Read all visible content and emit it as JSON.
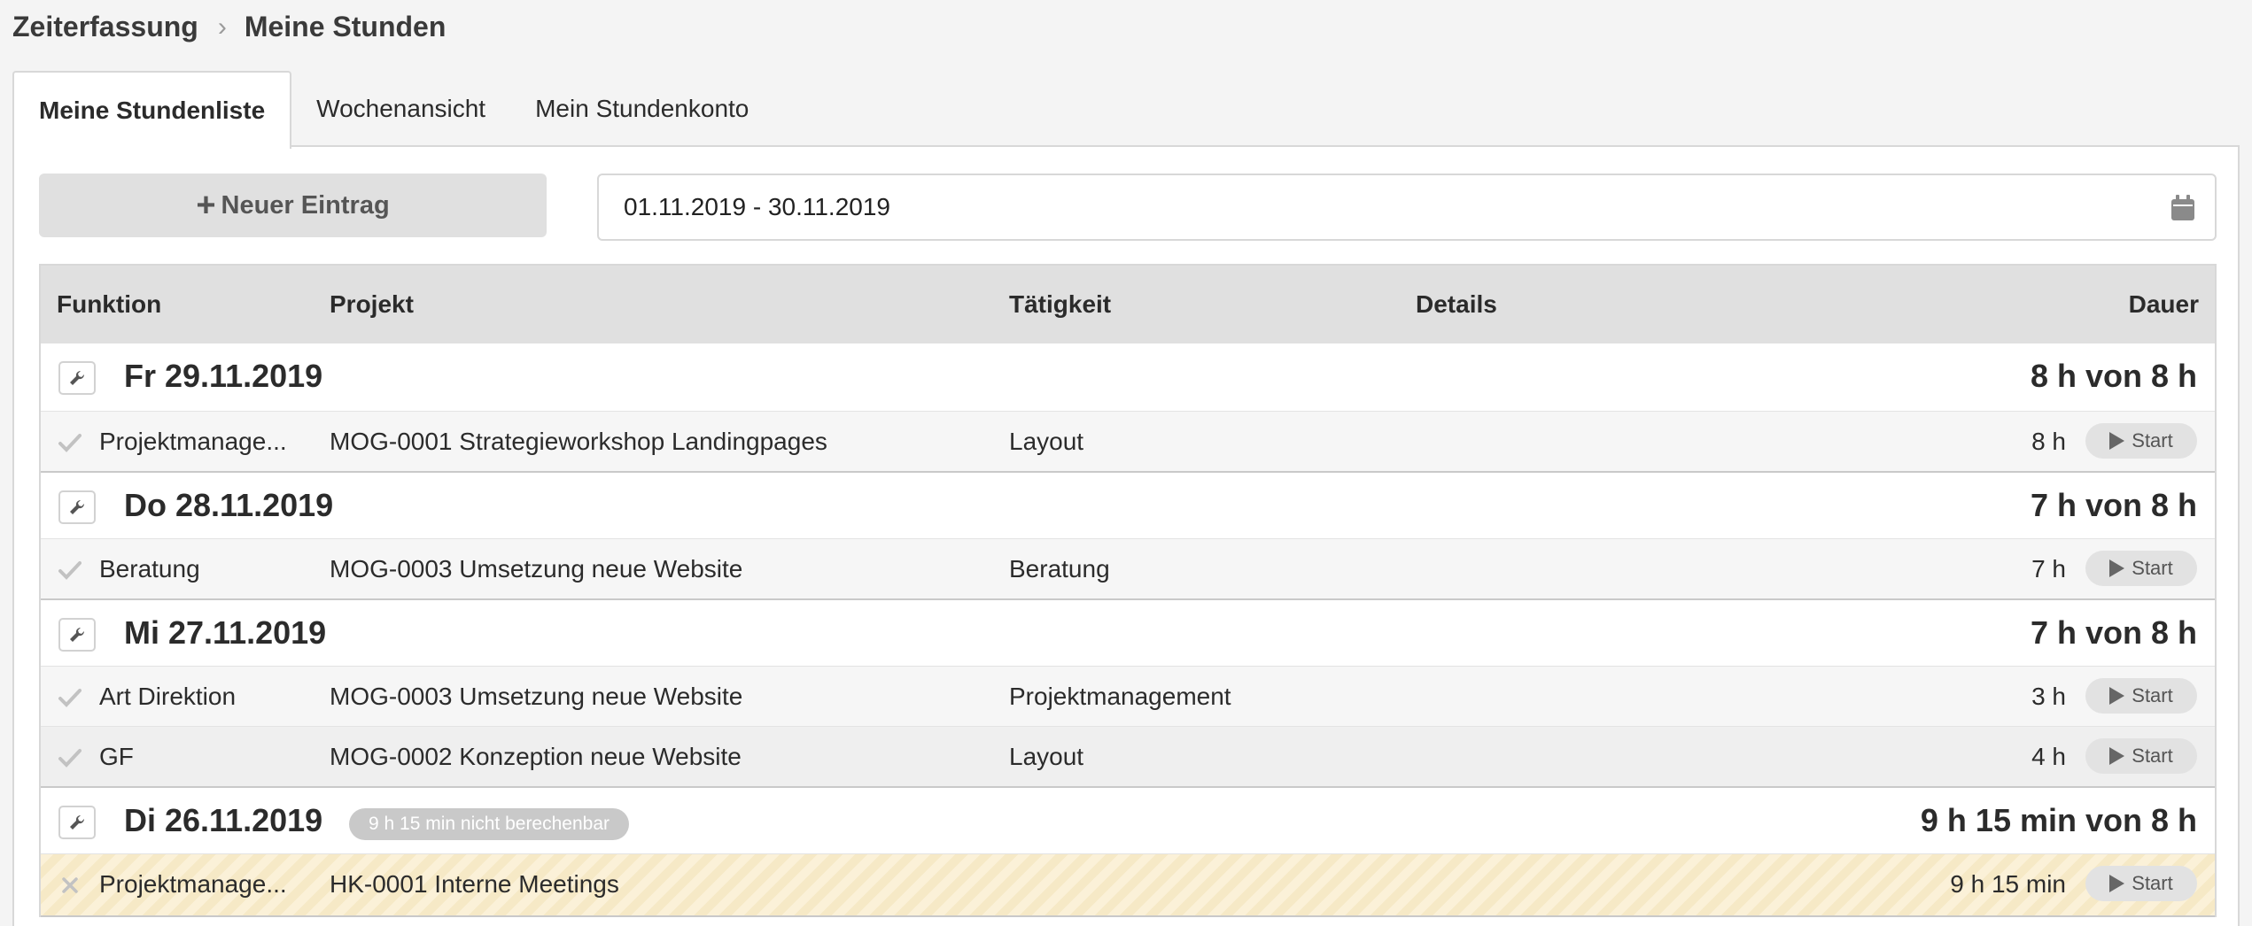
{
  "breadcrumb": {
    "parent": "Zeiterfassung",
    "separator": "›",
    "current": "Meine Stunden"
  },
  "tabs": [
    {
      "label": "Meine Stundenliste",
      "active": true
    },
    {
      "label": "Wochenansicht",
      "active": false
    },
    {
      "label": "Mein Stundenkonto",
      "active": false
    }
  ],
  "toolbar": {
    "new_entry_label": "Neuer Eintrag",
    "date_range": "01.11.2019 - 30.11.2019"
  },
  "table": {
    "headers": {
      "funktion": "Funktion",
      "projekt": "Projekt",
      "taetigkeit": "Tätigkeit",
      "details": "Details",
      "dauer": "Dauer"
    },
    "start_label": "Start",
    "days": [
      {
        "title": "Fr 29.11.2019",
        "total": "8 h von 8 h",
        "badge": "",
        "entries": [
          {
            "status": "check",
            "funktion": "Projektmanage...",
            "projekt": "MOG-0001 Strategieworkshop Landingpages",
            "taetigkeit": "Layout",
            "details": "",
            "dauer": "8 h"
          }
        ]
      },
      {
        "title": "Do 28.11.2019",
        "total": "7 h von 8 h",
        "badge": "",
        "entries": [
          {
            "status": "check",
            "funktion": "Beratung",
            "projekt": "MOG-0003 Umsetzung neue Website",
            "taetigkeit": "Beratung",
            "details": "",
            "dauer": "7 h"
          }
        ]
      },
      {
        "title": "Mi 27.11.2019",
        "total": "7 h von 8 h",
        "badge": "",
        "entries": [
          {
            "status": "check",
            "funktion": "Art Direktion",
            "projekt": "MOG-0003 Umsetzung neue Website",
            "taetigkeit": "Projektmanagement",
            "details": "",
            "dauer": "3 h"
          },
          {
            "status": "check",
            "funktion": "GF",
            "projekt": "MOG-0002 Konzeption neue Website",
            "taetigkeit": "Layout",
            "details": "",
            "dauer": "4 h"
          }
        ]
      },
      {
        "title": "Di 26.11.2019",
        "total": "9 h 15 min von 8 h",
        "badge": "9 h 15 min nicht berechenbar",
        "entries": [
          {
            "status": "cross",
            "funktion": "Projektmanage...",
            "projekt": "HK-0001 Interne Meetings",
            "taetigkeit": "",
            "details": "",
            "dauer": "9 h 15 min"
          }
        ]
      }
    ]
  }
}
